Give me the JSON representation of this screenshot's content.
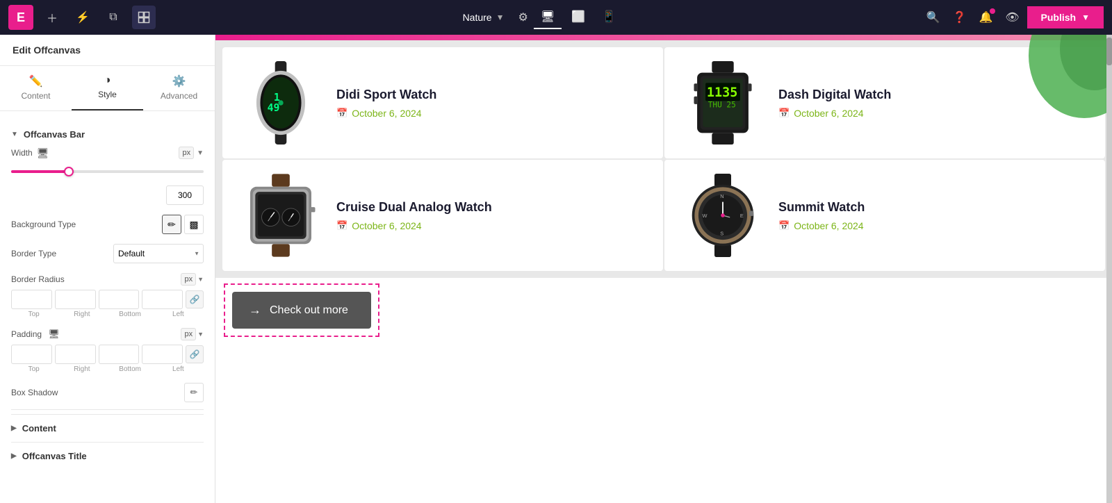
{
  "topbar": {
    "logo_text": "E",
    "site_name": "Nature",
    "tabs": [
      {
        "id": "desktop",
        "icon": "🖥",
        "active": true
      },
      {
        "id": "tablet",
        "icon": "⬜",
        "active": false
      },
      {
        "id": "mobile",
        "icon": "📱",
        "active": false
      }
    ],
    "publish_label": "Publish"
  },
  "panel": {
    "header": "Edit Offcanvas",
    "tabs": [
      {
        "id": "content",
        "label": "Content",
        "icon": "✏️"
      },
      {
        "id": "style",
        "label": "Style",
        "icon": "◑"
      },
      {
        "id": "advanced",
        "label": "Advanced",
        "icon": "⚙️"
      }
    ],
    "active_tab": "style",
    "sections": {
      "offcanvas_bar": {
        "label": "Offcanvas Bar",
        "expanded": true,
        "width": {
          "label": "Width",
          "value": "300",
          "unit": "px",
          "slider_pct": 30
        },
        "background_type": {
          "label": "Background Type",
          "options": [
            "pen",
            "square"
          ]
        },
        "border_type": {
          "label": "Border Type",
          "value": "Default"
        },
        "border_radius": {
          "label": "Border Radius",
          "unit": "px",
          "top": "",
          "right": "",
          "bottom": "",
          "left": ""
        },
        "padding": {
          "label": "Padding",
          "unit": "px",
          "top": "",
          "right": "",
          "bottom": "",
          "left": ""
        },
        "box_shadow": {
          "label": "Box Shadow"
        }
      },
      "content": {
        "label": "Content",
        "expanded": false
      },
      "offcanvas_title": {
        "label": "Offcanvas Title",
        "expanded": false
      }
    }
  },
  "canvas": {
    "pink_bar": true,
    "products": [
      {
        "id": 1,
        "title": "Didi Sport Watch",
        "date": "October 6, 2024",
        "watch_type": "sport_oval"
      },
      {
        "id": 2,
        "title": "Dash Digital Watch",
        "date": "October 6, 2024",
        "watch_type": "digital_square"
      },
      {
        "id": 3,
        "title": "Cruise Dual Analog Watch",
        "date": "October 6, 2024",
        "watch_type": "analog_rect"
      },
      {
        "id": 4,
        "title": "Summit Watch",
        "date": "October 6, 2024",
        "watch_type": "summit_round"
      }
    ],
    "check_out_btn": {
      "label": "Check out more",
      "arrow": "→"
    }
  }
}
